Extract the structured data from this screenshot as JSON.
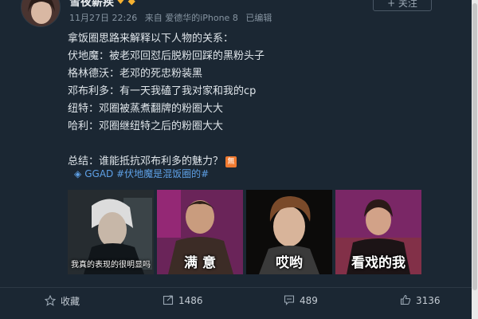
{
  "post": {
    "username": "雪夜薪疾",
    "time": "11月27日 22:26",
    "source": "来自 爱德华的iPhone 8",
    "edited": "已编辑",
    "follow_label": "+ 关注",
    "lines": [
      "拿饭圈思路来解释以下人物的关系：",
      "伏地魔：被老邓回怼后脱粉回踩的黑粉头子",
      "格林德沃：老邓的死忠粉装黑",
      "邓布利多：有一天我磕了我对家和我的cp",
      "纽特：邓圈被蒸煮翻牌的粉圈大大",
      "哈利：邓圈继纽特之后的粉圈大大"
    ],
    "summary": "总结：谁能抵抗邓布利多的魅力？",
    "summary_badge": "無",
    "topics": "GGAD #伏地魔是混饭圈的#",
    "images": [
      {
        "caption": "我真的表现的很明显吗"
      },
      {
        "caption": "满 意"
      },
      {
        "caption": "哎哟"
      },
      {
        "caption": "看戏的我"
      }
    ]
  },
  "actions": {
    "favorite": "收藏",
    "repost": "1486",
    "comment": "489",
    "like": "3136"
  },
  "colors": {
    "background": "#1b2733",
    "link": "#5ea0e6",
    "text": "#dfe5ea"
  }
}
